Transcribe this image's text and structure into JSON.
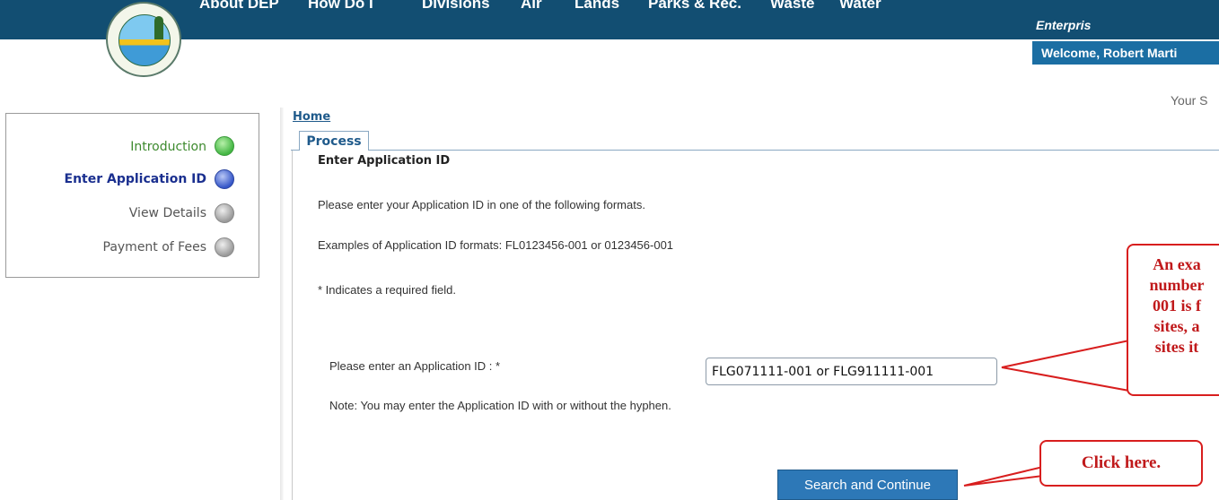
{
  "header": {
    "nav_items": [
      "About DEP",
      "How Do I",
      "Divisions",
      "Air",
      "Lands",
      "Parks & Rec.",
      "Waste",
      "Water"
    ],
    "enterprise_label": "Enterpris",
    "welcome_text": "Welcome, Robert Marti",
    "your_text": "Your S"
  },
  "colors": {
    "nav_bar": "#124e72",
    "welcome_bg": "#1b6ea3",
    "button_bg": "#2d78b7",
    "callout_red": "#d81e1e",
    "step_complete": "#43b643",
    "step_current": "#3556c8",
    "step_pending": "#9a9a9a"
  },
  "sidebar": {
    "steps": [
      {
        "label": "Introduction",
        "state": "complete",
        "icon": "check-circle-icon"
      },
      {
        "label": "Enter Application ID",
        "state": "current",
        "icon": "blue-dot-icon"
      },
      {
        "label": "View Details",
        "state": "pending",
        "icon": "gray-dot-icon"
      },
      {
        "label": "Payment of Fees",
        "state": "pending",
        "icon": "gray-dot-icon"
      }
    ]
  },
  "breadcrumb": {
    "home": "Home"
  },
  "tabs": {
    "process": "Process"
  },
  "form": {
    "title": "Enter Application ID",
    "instructions": "Please enter your Application ID in one of the following formats.",
    "examples": "Examples of Application ID formats: FL0123456-001 or 0123456-001",
    "required_note": "* Indicates a required field.",
    "app_id_label": "Please enter an Application ID : *",
    "app_id_value": "FLG071111-001 or FLG911111-001",
    "note": "Note: You may enter the Application ID with or without the hyphen.",
    "submit_label": "Search and Continue"
  },
  "callouts": {
    "example_lines": [
      "An exa",
      "number",
      "001 is f",
      "sites, a",
      "sites it"
    ],
    "click_here": "Click here."
  }
}
